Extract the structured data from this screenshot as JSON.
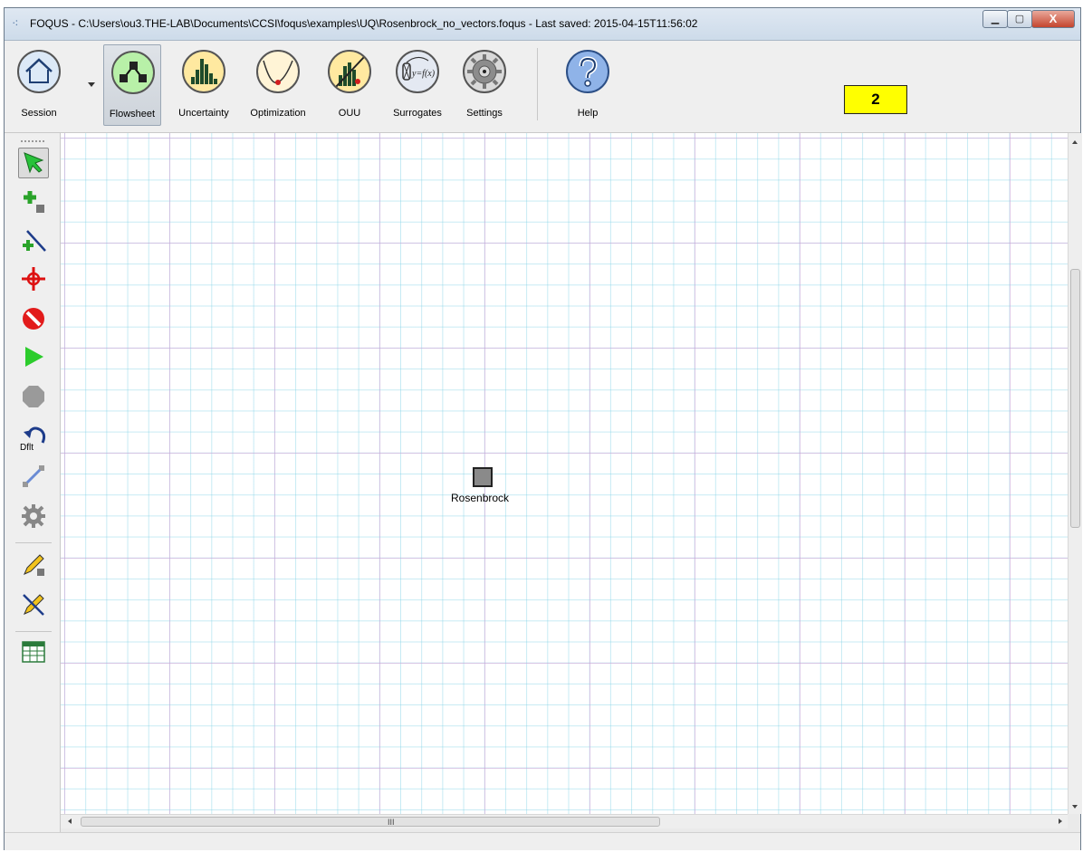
{
  "window": {
    "title": "FOQUS - C:\\Users\\ou3.THE-LAB\\Documents\\CCSI\\foqus\\examples\\UQ\\Rosenbrock_no_vectors.foqus - Last saved: 2015-04-15T11:56:02",
    "controls": [
      "minimize-icon",
      "maximize-icon",
      "close-icon"
    ],
    "close_label": "X"
  },
  "ribbon": {
    "session_label": "Session",
    "flowsheet_label": "Flowsheet",
    "uncertainty_label": "Uncertainty",
    "optimization_label": "Optimization",
    "ouu_label": "OUU",
    "surrogates_label": "Surrogates",
    "surrogates_icon_text": "y=f(x)",
    "settings_label": "Settings",
    "help_label": "Help",
    "active_tab": "Flowsheet"
  },
  "annotation": {
    "badge": "2"
  },
  "left_toolbar": {
    "tools": [
      "select-pointer-icon",
      "add-node-icon",
      "add-edge-icon",
      "center-view-icon",
      "delete-icon",
      "run-icon",
      "stop-icon",
      "default-reset-icon",
      "edge-tool-icon",
      "settings-gear-icon",
      "add-annotation-icon",
      "delete-annotation-icon",
      "table-icon"
    ],
    "default_label": "Dflt"
  },
  "flowsheet": {
    "nodes": [
      {
        "name": "Rosenbrock"
      }
    ]
  },
  "scrollbar": {
    "grip_text": "III"
  },
  "colors": {
    "grid_major": "#d6a3d6",
    "grid_minor": "#82d2e6",
    "badge": "#ffff00",
    "flowsheet_icon_bg": "#b8f0a8",
    "uq_icon_bg": "#ffe9a0",
    "help_icon_bg": "#8fb3e8"
  }
}
